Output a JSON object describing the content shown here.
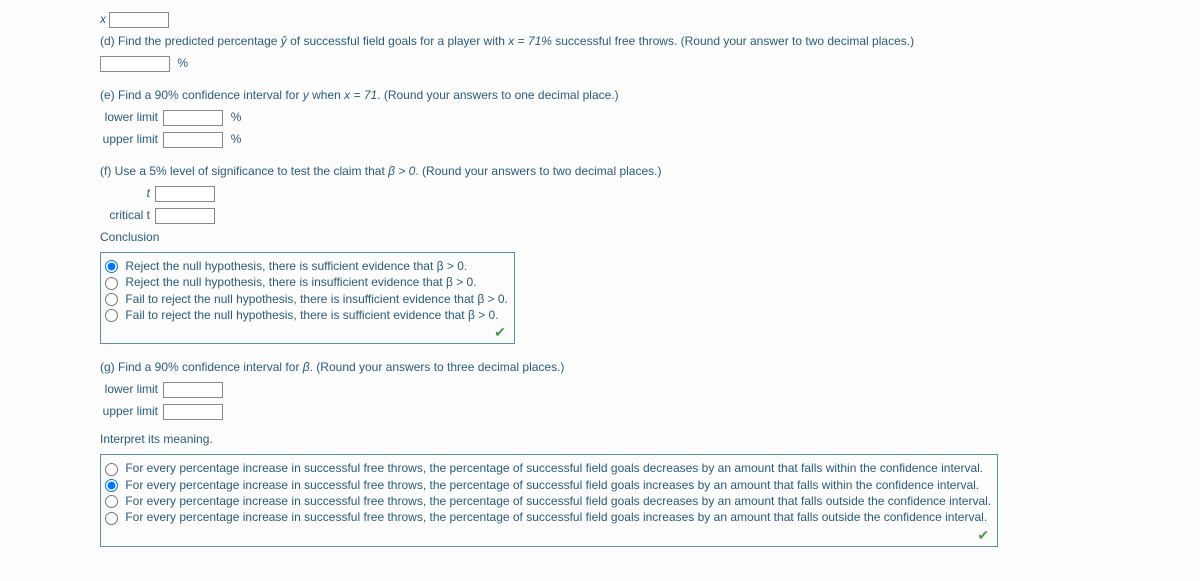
{
  "pre": {
    "x_label": "x"
  },
  "d": {
    "prompt_prefix": "(d) Find the predicted percentage ",
    "yhat": "ŷ",
    "prompt_mid": " of successful field goals for a player with ",
    "x_expr": "x = 71%",
    "prompt_tail": " successful free throws. (Round your answer to two decimal places.)",
    "unit": "%"
  },
  "e": {
    "prompt_prefix": "(e) Find a 90% confidence interval for ",
    "y_var": "y",
    "prompt_mid": " when ",
    "x_expr": "x = 71",
    "prompt_tail": ". (Round your answers to one decimal place.)",
    "lower_label": "lower limit",
    "upper_label": "upper limit",
    "unit": "%"
  },
  "f": {
    "prompt_prefix": "(f) Use a 5% level of significance to test the claim that ",
    "beta_expr": "β > 0",
    "prompt_tail": ". (Round your answers to two decimal places.)",
    "t_label": "t",
    "crit_label": "critical t",
    "conclusion_label": "Conclusion",
    "choices": [
      "Reject the null hypothesis, there is sufficient evidence that β > 0.",
      "Reject the null hypothesis, there is insufficient evidence that β > 0.",
      "Fail to reject the null hypothesis, there is insufficient evidence that β > 0.",
      "Fail to reject the null hypothesis, there is sufficient evidence that β > 0."
    ],
    "selected_index": 0
  },
  "g": {
    "prompt_prefix": "(g) Find a 90% confidence interval for ",
    "beta": "β",
    "prompt_tail": ". (Round your answers to three decimal places.)",
    "lower_label": "lower limit",
    "upper_label": "upper limit",
    "interpret_label": "Interpret its meaning.",
    "choices": [
      "For every percentage increase in successful free throws, the percentage of successful field goals decreases by an amount that falls within the confidence interval.",
      "For every percentage increase in successful free throws, the percentage of successful field goals increases by an amount that falls within the confidence interval.",
      "For every percentage increase in successful free throws, the percentage of successful field goals decreases by an amount that falls outside the confidence interval.",
      "For every percentage increase in successful free throws, the percentage of successful field goals increases by an amount that falls outside the confidence interval."
    ],
    "selected_index": 1
  },
  "check": "✔"
}
